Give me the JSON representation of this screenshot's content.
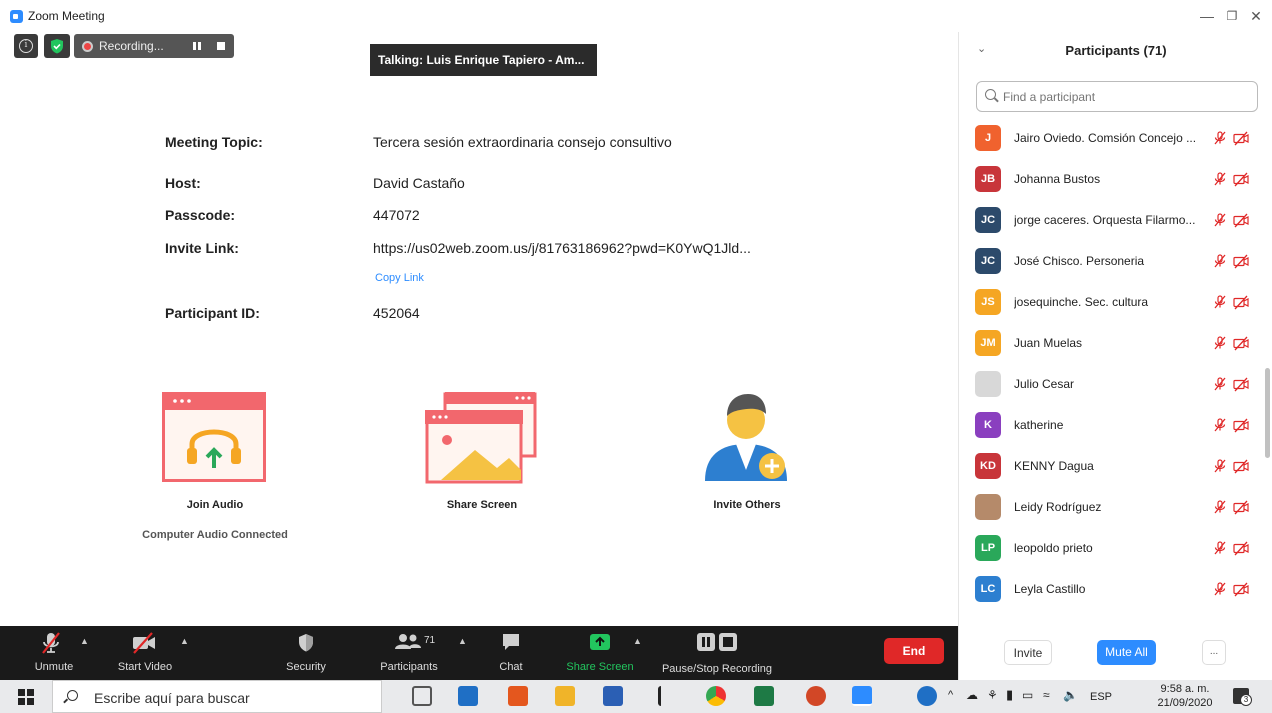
{
  "window": {
    "title": "Zoom Meeting"
  },
  "top_controls": {
    "recording_label": "Recording..."
  },
  "talking": "Talking: Luis Enrique Tapiero - Am...",
  "meeting": {
    "topic_label": "Meeting Topic:",
    "topic": "Tercera sesión extraordinaria consejo consultivo",
    "host_label": "Host:",
    "host": "David Castaño",
    "passcode_label": "Passcode:",
    "passcode": "447072",
    "invite_label": "Invite Link:",
    "invite_link": "https://us02web.zoom.us/j/81763186962?pwd=K0YwQ1Jld...",
    "copy_link": "Copy Link",
    "participant_id_label": "Participant ID:",
    "participant_id": "452064"
  },
  "tiles": {
    "join_audio": "Join Audio",
    "join_audio_sub": "Computer Audio Connected",
    "share_screen": "Share Screen",
    "invite_others": "Invite Others"
  },
  "participants_panel": {
    "title": "Participants (71)",
    "search_placeholder": "Find a participant",
    "participants": [
      {
        "initials": "J",
        "name": "Jairo Oviedo. Comsión Concejo ...",
        "color": "#f0622e"
      },
      {
        "initials": "JB",
        "name": "Johanna Bustos",
        "color": "#c8353a"
      },
      {
        "initials": "JC",
        "name": "jorge caceres. Orquesta Filarmo...",
        "color": "#2c4a6b"
      },
      {
        "initials": "JC",
        "name": "José Chisco. Personeria",
        "color": "#2c4a6b"
      },
      {
        "initials": "JS",
        "name": "josequinche. Sec. cultura",
        "color": "#f5a623"
      },
      {
        "initials": "JM",
        "name": "Juan Muelas",
        "color": "#f5a623"
      },
      {
        "initials": "",
        "name": "Julio Cesar",
        "color": "#d8d8d8"
      },
      {
        "initials": "K",
        "name": "katherine",
        "color": "#8a3fbf"
      },
      {
        "initials": "KD",
        "name": "KENNY Dagua",
        "color": "#c8353a"
      },
      {
        "initials": "",
        "name": "Leidy Rodríguez",
        "color": "#b58a6a"
      },
      {
        "initials": "LP",
        "name": "leopoldo prieto",
        "color": "#2aa85a"
      },
      {
        "initials": "LC",
        "name": "Leyla Castillo",
        "color": "#2d7fd0"
      }
    ],
    "invite_button": "Invite",
    "mute_all_button": "Mute All",
    "more_button": "..."
  },
  "toolbar": {
    "unmute": "Unmute",
    "start_video": "Start Video",
    "security": "Security",
    "participants": "Participants",
    "participants_count": "71",
    "chat": "Chat",
    "share_screen": "Share Screen",
    "pause_recording": "Pause/Stop Recording",
    "end": "End"
  },
  "taskbar": {
    "search_text": "Escribe aquí para buscar",
    "language": "ESP",
    "time": "9:58 a. m.",
    "date": "21/09/2020",
    "notifications": "3"
  },
  "colors": {
    "accent": "#2d8cff",
    "danger": "#e02828",
    "share_green": "#22c55e",
    "tile_red": "#f2676d"
  }
}
